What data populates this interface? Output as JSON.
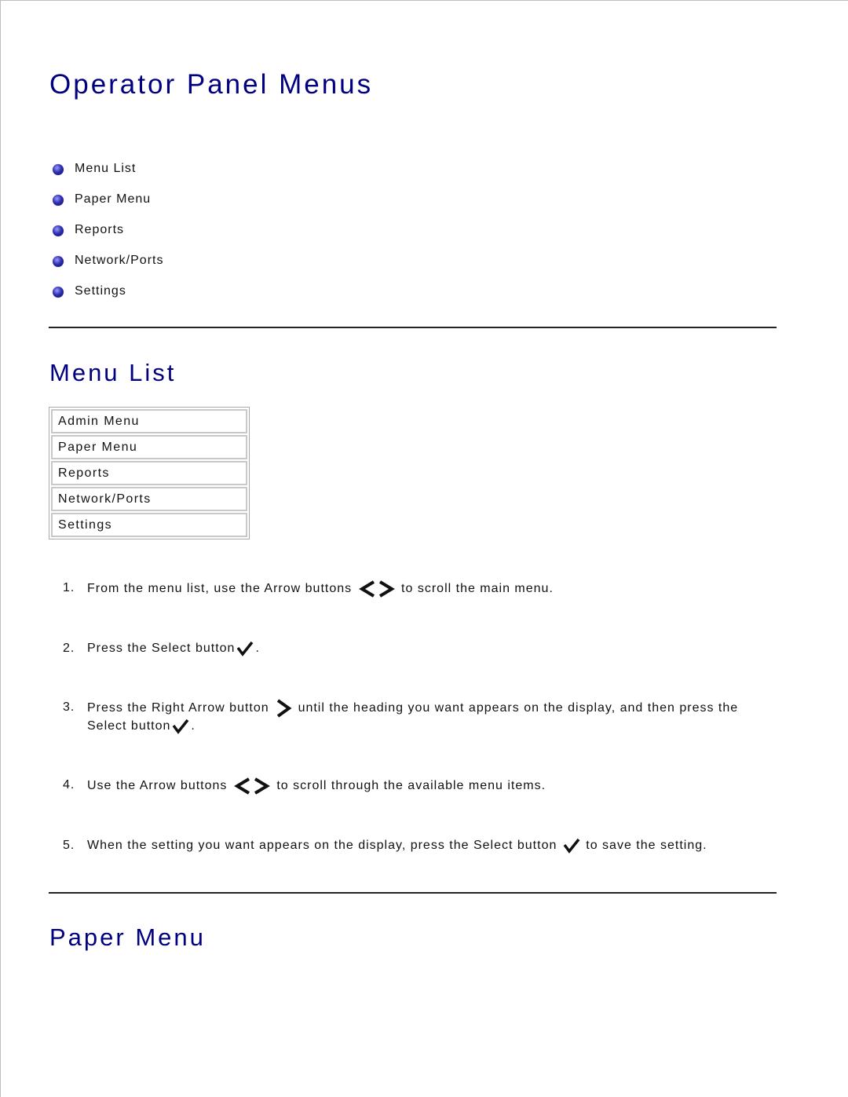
{
  "page": {
    "title": "Operator Panel Menus",
    "toc": [
      {
        "label": "Menu List"
      },
      {
        "label": "Paper Menu"
      },
      {
        "label": "Reports"
      },
      {
        "label": "Network/Ports"
      },
      {
        "label": "Settings"
      }
    ],
    "sections": {
      "menu_list": {
        "heading": "Menu List",
        "table_rows": [
          "Admin Menu",
          "Paper Menu",
          "Reports",
          "Network/Ports",
          "Settings"
        ],
        "steps": [
          {
            "num": "1.",
            "before": "From the menu list, use the Arrow buttons",
            "icon": "left-right-arrows-icon",
            "after": "to scroll the main menu."
          },
          {
            "num": "2.",
            "before": "Press the Select button",
            "icon": "checkmark-icon",
            "after": "."
          },
          {
            "num": "3.",
            "before": "Press the Right Arrow button",
            "icon": "right-arrow-icon",
            "middle": "until the heading you want appears on the display, and then press the Select button",
            "icon2": "checkmark-icon",
            "after": "."
          },
          {
            "num": "4.",
            "before": "Use the Arrow buttons",
            "icon": "left-right-arrows-icon",
            "after": "to scroll through the available menu items."
          },
          {
            "num": "5.",
            "before": "When the setting you want appears on the display, press the Select button",
            "icon": "checkmark-icon",
            "after": "to save the setting."
          }
        ]
      },
      "paper_menu": {
        "heading": "Paper Menu"
      }
    },
    "colors": {
      "heading": "#000080",
      "text": "#111111",
      "rule": "#222222"
    }
  }
}
